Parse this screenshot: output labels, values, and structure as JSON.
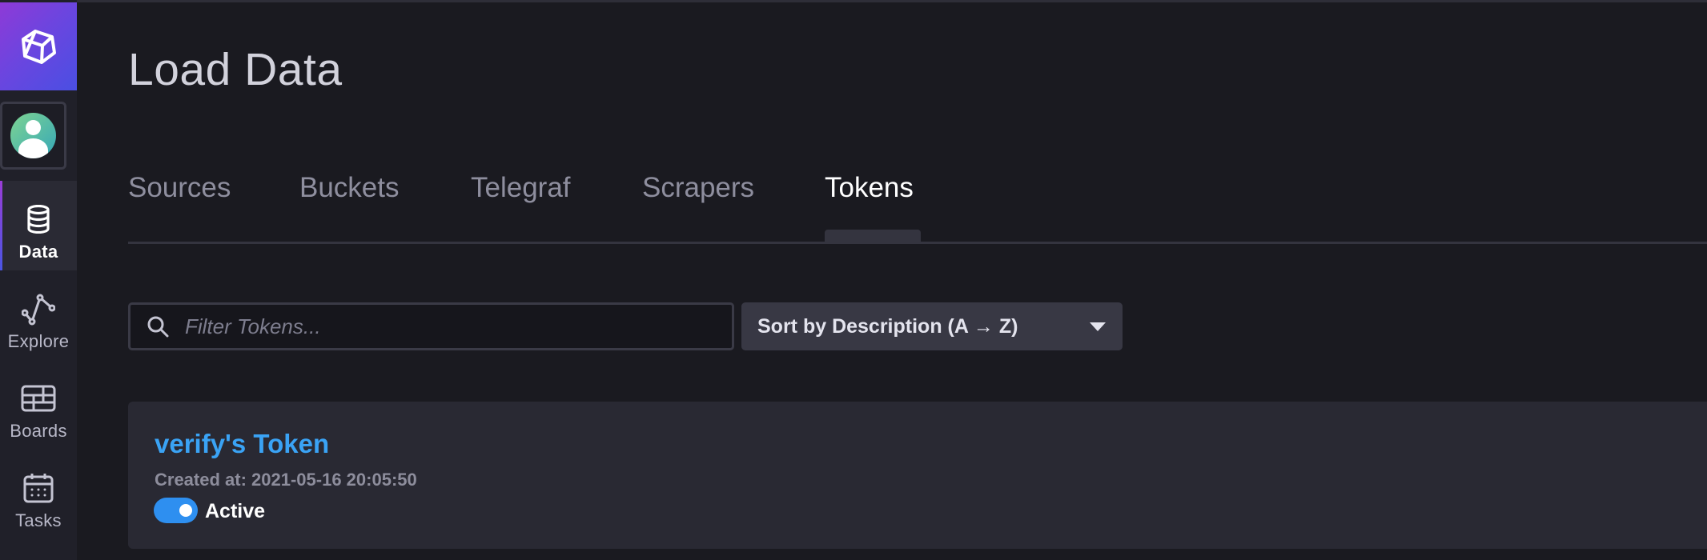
{
  "page": {
    "title": "Load Data"
  },
  "sidebar": {
    "items": [
      {
        "label": "Data",
        "icon": "database-icon",
        "active": true
      },
      {
        "label": "Explore",
        "icon": "graph-icon",
        "active": false
      },
      {
        "label": "Boards",
        "icon": "dashboard-icon",
        "active": false
      },
      {
        "label": "Tasks",
        "icon": "calendar-icon",
        "active": false
      }
    ]
  },
  "tabs": [
    {
      "label": "Sources",
      "active": false
    },
    {
      "label": "Buckets",
      "active": false
    },
    {
      "label": "Telegraf",
      "active": false
    },
    {
      "label": "Scrapers",
      "active": false
    },
    {
      "label": "Tokens",
      "active": true
    }
  ],
  "filter": {
    "placeholder": "Filter Tokens...",
    "value": ""
  },
  "sort": {
    "selected": "Sort by Description (A → Z)"
  },
  "tokens": [
    {
      "name": "verify's Token",
      "created": "Created at: 2021-05-16 20:05:50",
      "status": "Active"
    }
  ],
  "colors": {
    "accent": "#3aa3f5",
    "toggle_on": "#2e8ff0",
    "background": "#1a1a20",
    "sidebar": "#202029",
    "logo_gradient_start": "#8e3ad7",
    "logo_gradient_end": "#4a4fe3"
  }
}
